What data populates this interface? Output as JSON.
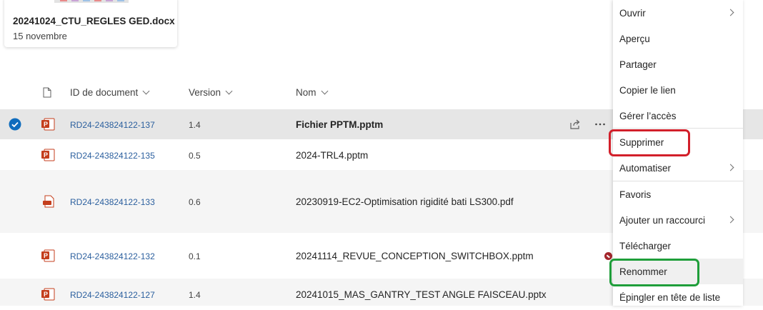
{
  "recent_card": {
    "title": "20241024_CTU_REGLES GED.docx",
    "date": "15 novembre"
  },
  "columns": {
    "file_type_icon": "file-icon",
    "id": "ID de document",
    "version": "Version",
    "name": "Nom"
  },
  "rows": [
    {
      "id": "RD24-243824122-137",
      "version": "1.4",
      "name": "Fichier PPTM.pptm",
      "type": "powerpoint-icon",
      "selected": true
    },
    {
      "id": "RD24-243824122-135",
      "version": "0.5",
      "name": "2024-TRL4.pptm",
      "type": "powerpoint-icon",
      "selected": false
    },
    {
      "id": "RD24-243824122-133",
      "version": "0.6",
      "name": "20230919-EC2-Optimisation rigidité bati LS300.pdf",
      "type": "pdf-icon",
      "selected": false
    },
    {
      "id": "RD24-243824122-132",
      "version": "0.1",
      "name": "20241114_REVUE_CONCEPTION_SWITCHBOX.pptm",
      "type": "powerpoint-icon",
      "selected": false
    },
    {
      "id": "RD24-243824122-127",
      "version": "1.4",
      "name": "20241015_MAS_GANTRY_TEST ANGLE FAISCEAU.pptx",
      "type": "powerpoint-icon",
      "selected": false
    }
  ],
  "row_actions": {
    "share_icon": "share-icon",
    "more_icon": "more-options-icon"
  },
  "context_menu": {
    "items": [
      {
        "label": "Ouvrir",
        "submenu": true
      },
      {
        "label": "Aperçu",
        "submenu": false
      },
      {
        "label": "Partager",
        "submenu": false
      },
      {
        "label": "Copier le lien",
        "submenu": false
      },
      {
        "label": "Gérer l’accès",
        "submenu": false
      },
      {
        "label": "Supprimer",
        "submenu": false
      },
      {
        "label": "Automatiser",
        "submenu": true
      },
      {
        "label": "Favoris",
        "submenu": false
      },
      {
        "label": "Ajouter un raccourci",
        "submenu": true
      },
      {
        "label": "Télécharger",
        "submenu": false
      },
      {
        "label": "Renommer",
        "submenu": false
      },
      {
        "label": "Épingler en tête de liste",
        "submenu": false
      }
    ]
  },
  "colors": {
    "selected_row": "#e6e6e6",
    "link": "#2b5f9e",
    "highlight_red": "#d21f2a",
    "highlight_green": "#1f9e3a",
    "check_blue": "#0f6cbd",
    "powerpoint": "#c43e1c"
  }
}
